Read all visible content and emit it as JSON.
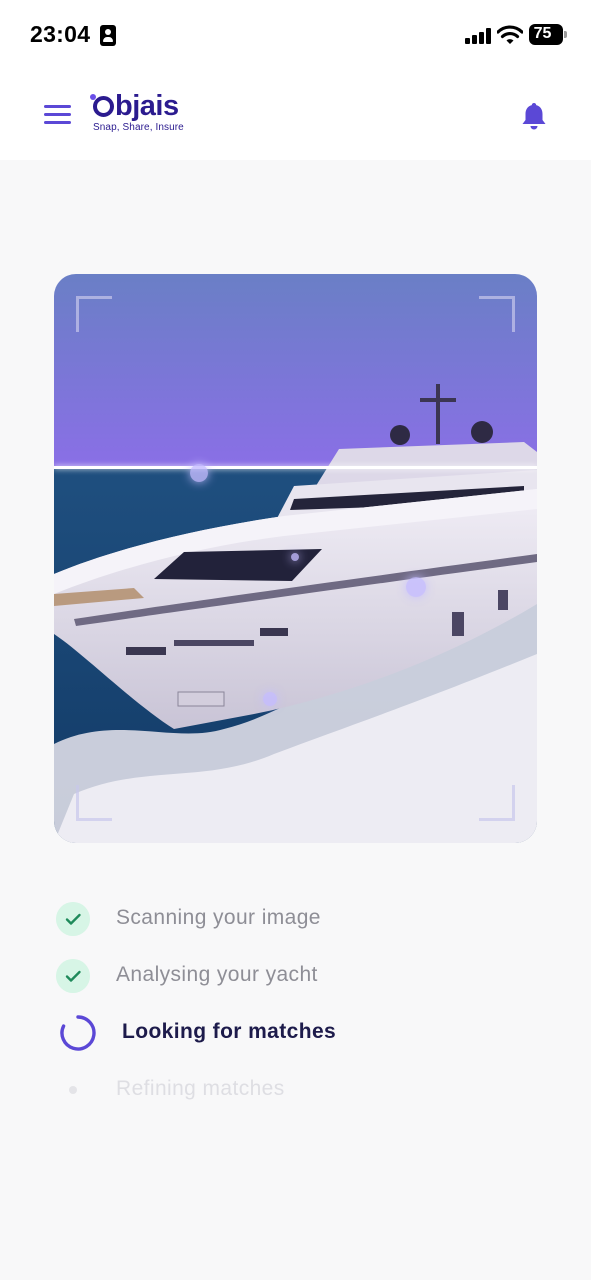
{
  "status_bar": {
    "time": "23:04",
    "battery": "75"
  },
  "header": {
    "logo_text": "Objais",
    "logo_tagline": "Snap, Share, Insure"
  },
  "scan": {
    "subject": "yacht photo being scanned"
  },
  "steps": [
    {
      "label": "Scanning your image",
      "state": "done"
    },
    {
      "label": "Analysing your yacht",
      "state": "done"
    },
    {
      "label": "Looking for matches",
      "state": "in-progress"
    },
    {
      "label": "Refining matches",
      "state": "pending"
    }
  ],
  "colors": {
    "accent": "#5b48d6",
    "brand": "#2b1b8f",
    "success_bg": "#d7f5e6",
    "success": "#1f8a5b"
  }
}
